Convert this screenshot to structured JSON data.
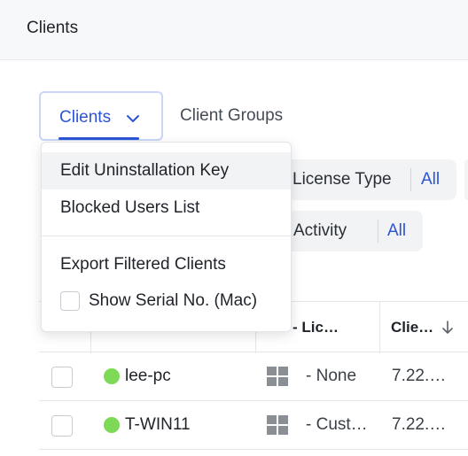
{
  "header": {
    "title": "Clients"
  },
  "tabs": {
    "clients_label": "Clients",
    "groups_label": "Client Groups"
  },
  "filters": {
    "license_type": {
      "label": "License Type",
      "value": "All"
    },
    "last_activity": {
      "label": "st Activity",
      "value": "All"
    }
  },
  "table": {
    "columns": [
      "- Lic…",
      "Clie…"
    ],
    "rows": [
      {
        "name": "lee-pc",
        "status": "online",
        "os": "windows-icon",
        "license": "- None",
        "version": "7.22.…"
      },
      {
        "name": "T-WIN11",
        "status": "online",
        "os": "windows-icon",
        "license": "- Cust…",
        "version": "7.22.…"
      }
    ]
  },
  "menu": {
    "items": [
      "Edit Uninstallation Key",
      "Blocked Users List",
      "Export Filtered Clients"
    ],
    "serial_option": "Show Serial No. (Mac)"
  },
  "colors": {
    "accent": "#2b55d6",
    "online": "#7ed957",
    "pill_bg": "#f2f3f5"
  }
}
